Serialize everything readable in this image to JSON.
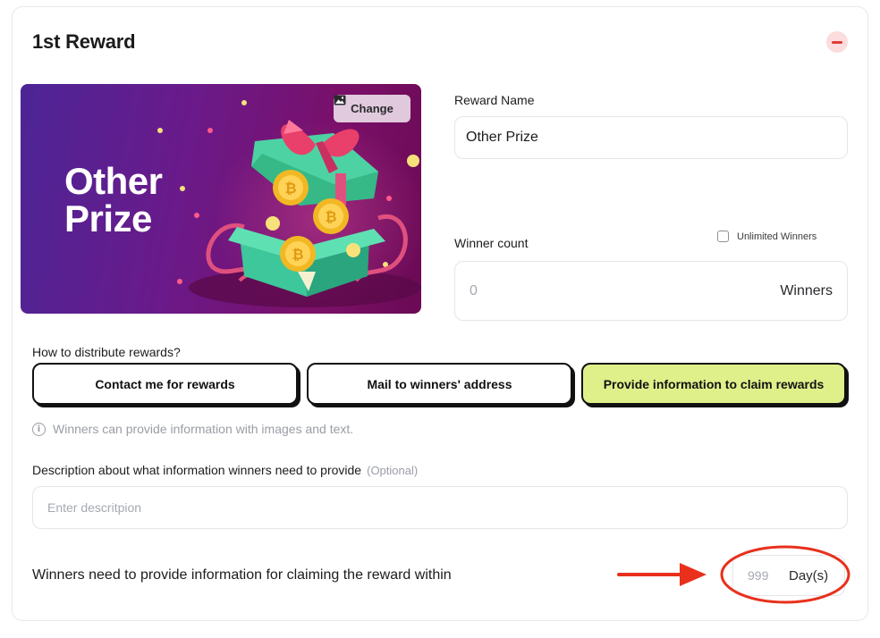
{
  "card": {
    "title": "1st Reward",
    "remove_icon": "minus-circle-icon"
  },
  "prize_image": {
    "text": "Other Prize",
    "change_label": "Change",
    "change_icon": "image-icon"
  },
  "reward_name": {
    "label": "Reward Name",
    "value": "Other Prize"
  },
  "winner_count": {
    "label": "Winner count",
    "unlimited_label": "Unlimited Winners",
    "unlimited_checked": false,
    "placeholder": "0",
    "unit": "Winners"
  },
  "distribution": {
    "question": "How to distribute rewards?",
    "options": [
      {
        "label": "Contact me for rewards",
        "selected": false
      },
      {
        "label": "Mail to winners' address",
        "selected": false
      },
      {
        "label": "Provide information to claim rewards",
        "selected": true
      }
    ],
    "hint": "Winners can provide information with images and text."
  },
  "description": {
    "label": "Description about what information winners need to provide",
    "optional": "(Optional)",
    "placeholder": "Enter descritpion"
  },
  "claim": {
    "label": "Winners need to provide information for claiming the reward within",
    "placeholder": "999",
    "unit": "Day(s)"
  },
  "colors": {
    "accent_selected": "#dff08a",
    "remove_bg": "#fcdcdc",
    "remove_fg": "#e23c3c",
    "annotation_red": "#e8301c"
  }
}
